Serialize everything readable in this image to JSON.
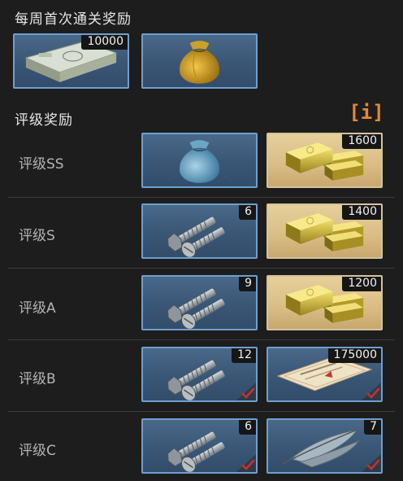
{
  "weekly": {
    "title": "每周首次通关奖励",
    "items": [
      {
        "icon": "cash-stack-icon",
        "count": "10000"
      },
      {
        "icon": "gold-pouch-icon",
        "count": ""
      }
    ]
  },
  "rating": {
    "title": "评级奖励",
    "info_label": "[i]",
    "rows": [
      {
        "label": "评级SS",
        "items": [
          {
            "icon": "blue-pouch-icon",
            "count": ""
          },
          {
            "icon": "gold-bars-icon",
            "count": "1600"
          }
        ]
      },
      {
        "label": "评级S",
        "items": [
          {
            "icon": "bolts-icon",
            "count": "6"
          },
          {
            "icon": "gold-bars-icon",
            "count": "1400"
          }
        ]
      },
      {
        "label": "评级A",
        "items": [
          {
            "icon": "bolts-icon",
            "count": "9"
          },
          {
            "icon": "gold-bars-icon",
            "count": "1200"
          }
        ]
      },
      {
        "label": "评级B",
        "items": [
          {
            "icon": "bolts-icon",
            "count": "12",
            "claimed": true
          },
          {
            "icon": "document-icon",
            "count": "175000",
            "claimed": true
          }
        ]
      },
      {
        "label": "评级C",
        "items": [
          {
            "icon": "bolts-icon",
            "count": "6",
            "claimed": true
          },
          {
            "icon": "feather-icon",
            "count": "7",
            "claimed": true
          }
        ]
      }
    ]
  },
  "colors": {
    "card_blue": "#3a5675",
    "card_gold": "#d9bd84",
    "info_orange": "#e48a30",
    "check_red": "#c0392b"
  }
}
